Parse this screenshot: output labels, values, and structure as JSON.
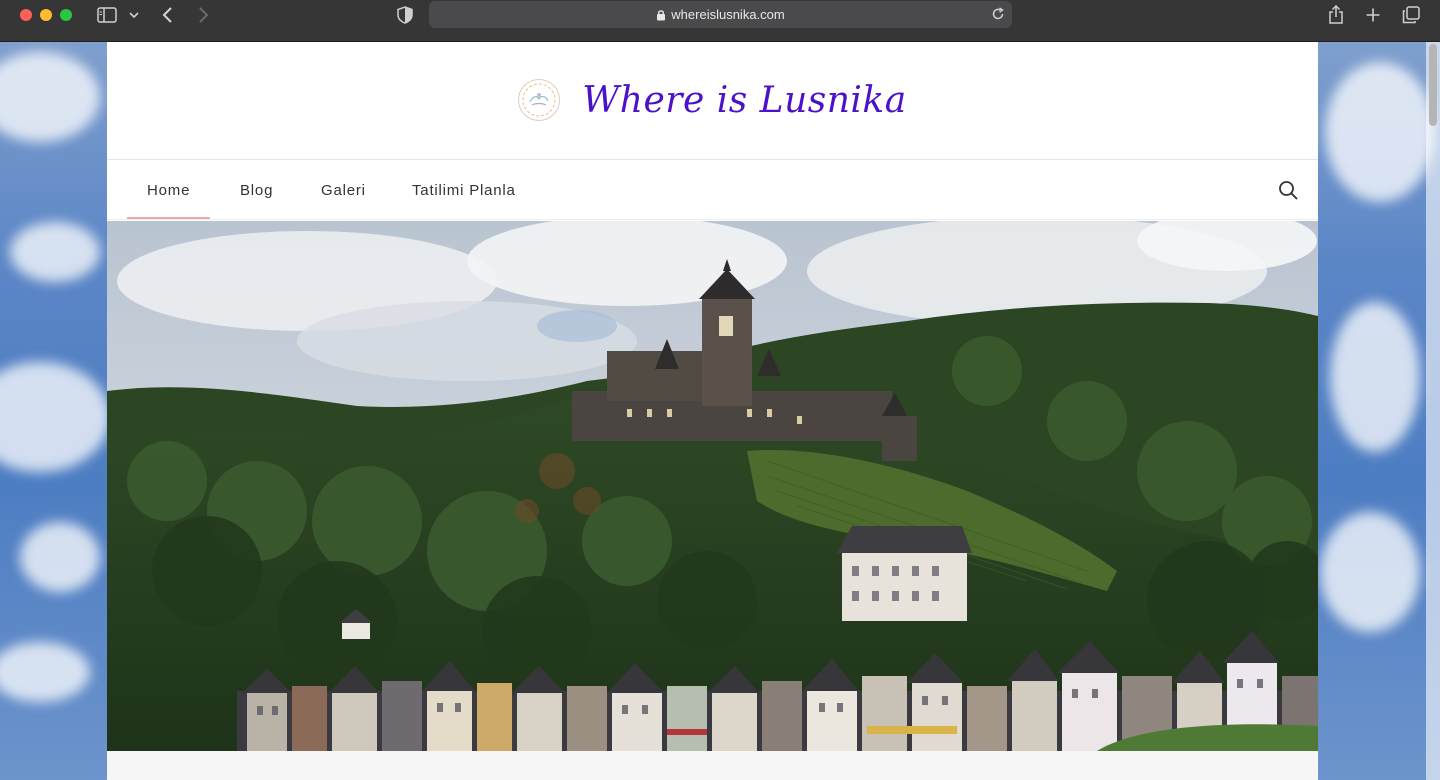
{
  "browser": {
    "url": "whereislusnika.com",
    "icons": [
      "sidebar-icon",
      "chevron-down-icon",
      "back-arrow-icon",
      "forward-arrow-icon",
      "shield-icon",
      "lock-icon",
      "reload-icon",
      "share-icon",
      "new-tab-icon",
      "tab-overview-icon"
    ]
  },
  "site": {
    "title": "Where is Lusnika",
    "title_color": "#4b12c9",
    "accent_color": "#f0a6a6"
  },
  "nav": {
    "items": [
      {
        "label": "Home",
        "active": true
      },
      {
        "label": "Blog",
        "active": false
      },
      {
        "label": "Galeri",
        "active": false
      },
      {
        "label": "Tatilimi Planla",
        "active": false
      }
    ],
    "search_icon": "search-icon"
  },
  "hero": {
    "image_subject": "castle-on-hill-above-riverside-town"
  }
}
